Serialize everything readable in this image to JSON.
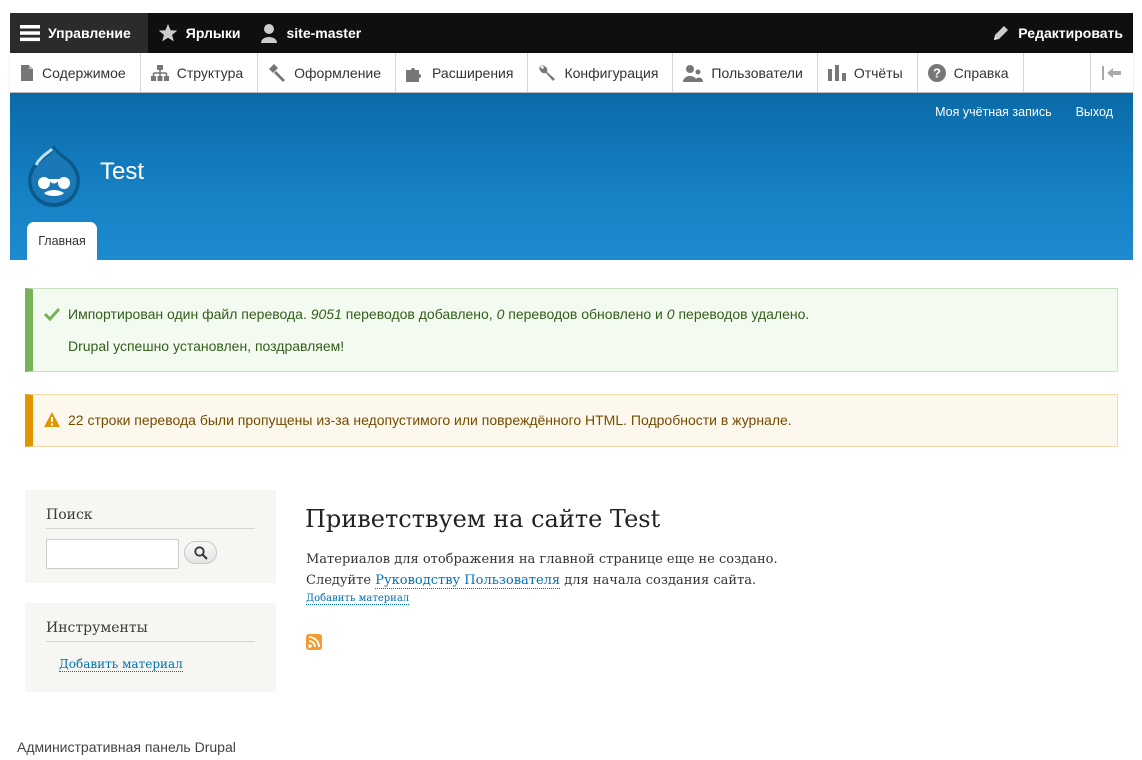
{
  "toolbar": {
    "manage": "Управление",
    "shortcuts": "Ярлыки",
    "user": "site-master",
    "edit": "Редактировать"
  },
  "tray": {
    "items": [
      "Содержимое",
      "Структура",
      "Оформление",
      "Расширения",
      "Конфигурация",
      "Пользователи",
      "Отчёты",
      "Справка"
    ]
  },
  "header": {
    "account": "Моя учётная запись",
    "logout": "Выход",
    "site_name": "Test",
    "tab_home": "Главная"
  },
  "messages": {
    "status_line1_a": "Импортирован один файл перевода. ",
    "status_line1_added": "9051",
    "status_line1_b": " переводов добавлено, ",
    "status_line1_updated": "0",
    "status_line1_c": " переводов обновлено и ",
    "status_line1_deleted": "0",
    "status_line1_d": " переводов удалено.",
    "status_line2": "Drupal успешно установлен, поздравляем!",
    "warning": "22 строки перевода были пропущены из-за недопустимого или повреждённого HTML. Подробности в журнале."
  },
  "sidebar": {
    "search_title": "Поиск",
    "tools_title": "Инструменты",
    "tools_link": "Добавить материал"
  },
  "main": {
    "title": "Приветствуем на сайте Test",
    "text1": "Материалов для отображения на главной странице еще не создано.",
    "text2_a": "Следуйте ",
    "text2_link": "Руководству Пользователя",
    "text2_b": " для начала создания сайта.",
    "add_link": "Добавить материал"
  },
  "footer": {
    "text": "Административная панель Drupal"
  },
  "colors": {
    "toolbar_bg": "#0f0f0f",
    "header_blue": "#1681c4",
    "status_accent": "#77b259",
    "warning_accent": "#e09600",
    "link": "#0071b3"
  }
}
